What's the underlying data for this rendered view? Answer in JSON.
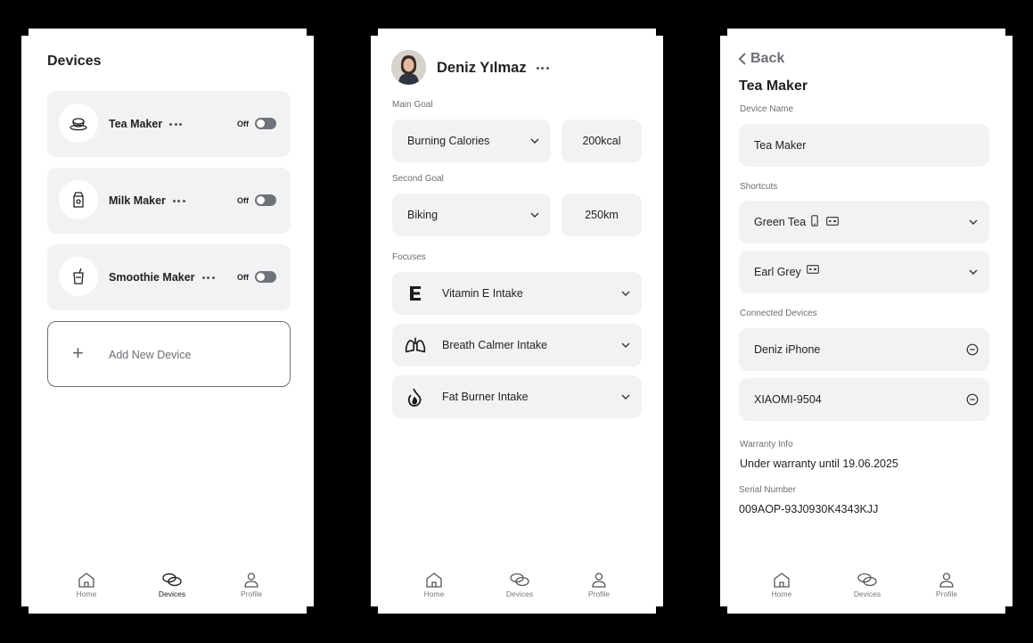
{
  "screen1": {
    "title": "Devices",
    "devices": [
      {
        "name": "Tea Maker",
        "status": "Off",
        "icon": "teacup-icon"
      },
      {
        "name": "Milk Maker",
        "status": "Off",
        "icon": "milk-carton-icon"
      },
      {
        "name": "Smoothie Maker",
        "status": "Off",
        "icon": "smoothie-cup-icon"
      }
    ],
    "add_label": "Add New Device",
    "add_icon": "plus"
  },
  "screen2": {
    "user_name": "Deniz Yılmaz",
    "main_goal_label": "Main Goal",
    "main_goal_value": "Burning Calories",
    "main_goal_amount": "200kcal",
    "second_goal_label": "Second Goal",
    "second_goal_value": "Biking",
    "second_goal_amount": "250km",
    "focuses_label": "Focuses",
    "focuses": [
      {
        "label": "Vitamin E Intake",
        "icon": "vitamin-e-icon"
      },
      {
        "label": "Breath Calmer Intake",
        "icon": "lungs-icon"
      },
      {
        "label": "Fat Burner Intake",
        "icon": "flame-drop-icon"
      }
    ]
  },
  "screen3": {
    "back_label": "Back",
    "title": "Tea Maker",
    "device_name_label": "Device Name",
    "device_name_value": "Tea Maker",
    "shortcuts_label": "Shortcuts",
    "shortcuts": [
      {
        "label": "Green Tea",
        "icons": [
          "phone-icon",
          "card-icon"
        ]
      },
      {
        "label": "Earl Grey",
        "icons": [
          "card-icon"
        ]
      }
    ],
    "connected_label": "Connected Devices",
    "connected": [
      {
        "label": "Deniz iPhone"
      },
      {
        "label": "XIAOMI-9504"
      }
    ],
    "warranty_label": "Warranty Info",
    "warranty_value": "Under warranty until 19.06.2025",
    "serial_label": "Serial Number",
    "serial_value": "009AOP-93J0930K4343KJJ"
  },
  "tabbar": {
    "tabs": [
      {
        "label": "Home",
        "icon": "home-icon"
      },
      {
        "label": "Devices",
        "icon": "devices-link-icon"
      },
      {
        "label": "Profile",
        "icon": "profile-icon"
      }
    ],
    "active_screen1": "Devices"
  }
}
